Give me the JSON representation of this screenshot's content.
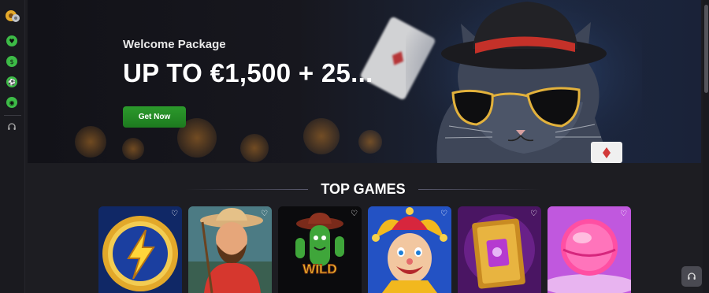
{
  "sidebar": {
    "logo_icon": "chip-logo-icon",
    "items": [
      {
        "name": "heart-dice-icon",
        "color": "#3dbb47"
      },
      {
        "name": "coin-icon",
        "color": "#3dbb47"
      },
      {
        "name": "ball-icon",
        "color": "#3dbb47"
      },
      {
        "name": "chip-icon",
        "color": "#3dbb47"
      }
    ],
    "support_icon": "headset-icon"
  },
  "banner": {
    "welcome": "Welcome Package",
    "headline": "UP TO €1,500 + 25...",
    "cta_label": "Get Now",
    "cta_color": "#239227"
  },
  "top_games": {
    "title": "TOP GAMES",
    "tiles": [
      {
        "name": "lightning-coin-game",
        "label": "",
        "fav_icon": "heart-icon"
      },
      {
        "name": "fisherman-game",
        "label": "",
        "fav_icon": "heart-icon"
      },
      {
        "name": "cactus-wild-game",
        "label": "WILD",
        "fav_icon": "heart-icon"
      },
      {
        "name": "joker-game",
        "label": "",
        "fav_icon": "heart-icon"
      },
      {
        "name": "golden-book-game",
        "label": "",
        "fav_icon": "heart-icon"
      },
      {
        "name": "candy-game",
        "label": "",
        "fav_icon": "heart-icon"
      }
    ]
  },
  "support_button": {
    "icon": "headset-icon"
  }
}
